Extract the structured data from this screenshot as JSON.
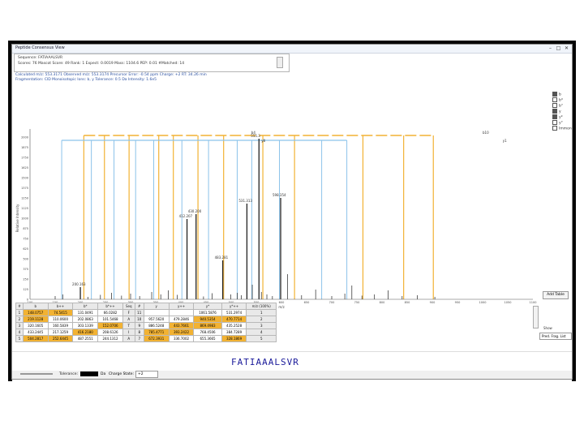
{
  "window": {
    "title": "Peptide Consensus View"
  },
  "header": {
    "sequence_line": "Sequence: FATIAAALSVR",
    "scores_line": "Scores: 76  Mascot Score: 49   Rank: 1  Expect: 0.0019   Mass: 1104.6   PEP: 0.01   #Matched: 14",
    "computed_line": "Calculated m/z: 553.3171  Observed m/z: 553.3174  Precursor Error: -0.54 ppm  Charge: +2  RT: 34.26 min",
    "extra_line": "Fragmentation: CID  Monoisotopic  Ions: b, y  Tolerance: 0.5 Da  Intensity: 1.6e5"
  },
  "legend": [
    {
      "label": "b",
      "checked": true
    },
    {
      "label": "b*",
      "checked": false
    },
    {
      "label": "b°",
      "checked": false
    },
    {
      "label": "y",
      "checked": true
    },
    {
      "label": "y*",
      "checked": true
    },
    {
      "label": "y°",
      "checked": false
    },
    {
      "label": "Immonium",
      "checked": false
    }
  ],
  "chart_data": {
    "type": "bar",
    "ylabel": "Relative Intensity",
    "ylim": [
      0,
      2000
    ],
    "yticks": [
      0,
      125,
      250,
      375,
      500,
      625,
      750,
      875,
      1000,
      1125,
      1250,
      1375,
      1500,
      1625,
      1750,
      1875,
      2000
    ],
    "xlim": [
      100,
      1100
    ],
    "xticks": [
      100,
      150,
      200,
      250,
      300,
      350,
      400,
      450,
      500,
      550,
      600,
      650,
      700,
      750,
      800,
      850,
      900,
      950,
      1000,
      1050,
      1100
    ],
    "xlabel": "m/z",
    "peaks_labeled": [
      {
        "x": 200.1,
        "y": 150,
        "label": "200.163"
      },
      {
        "x": 430.2,
        "y": 1050,
        "label": "430.200"
      },
      {
        "x": 412.2,
        "y": 990,
        "label": "412.207"
      },
      {
        "x": 483.3,
        "y": 480,
        "label": "483.281"
      },
      {
        "x": 531.3,
        "y": 1180,
        "label": "531.313"
      },
      {
        "x": 598.4,
        "y": 1250,
        "label": "598.354"
      },
      {
        "x": 555.3,
        "y": 1980,
        "label": "555.3"
      }
    ],
    "peaks_unlabeled": [
      [
        150,
        40
      ],
      [
        165,
        60
      ],
      [
        215,
        30
      ],
      [
        240,
        55
      ],
      [
        262,
        80
      ],
      [
        282,
        45
      ],
      [
        300,
        70
      ],
      [
        318,
        40
      ],
      [
        342,
        90
      ],
      [
        360,
        60
      ],
      [
        375,
        110
      ],
      [
        393,
        55
      ],
      [
        445,
        35
      ],
      [
        462,
        75
      ],
      [
        499,
        60
      ],
      [
        512,
        80
      ],
      [
        520,
        50
      ],
      [
        542,
        180
      ],
      [
        560,
        90
      ],
      [
        571,
        60
      ],
      [
        582,
        40
      ],
      [
        612,
        310
      ],
      [
        640,
        50
      ],
      [
        668,
        120
      ],
      [
        700,
        40
      ],
      [
        726,
        70
      ],
      [
        740,
        170
      ],
      [
        760,
        45
      ],
      [
        785,
        60
      ],
      [
        812,
        110
      ],
      [
        840,
        40
      ],
      [
        870,
        50
      ],
      [
        905,
        30
      ]
    ],
    "ion_lines_b": [
      207,
      248,
      297,
      356,
      385,
      434,
      485,
      563,
      626,
      762,
      843,
      902
    ],
    "ion_lines_y": [
      163,
      222,
      267,
      310,
      346,
      402,
      455,
      512,
      541,
      596,
      680,
      730
    ],
    "tags_top": [
      "b10",
      "y8",
      "b4",
      "y1"
    ]
  },
  "table": {
    "headers": [
      "#",
      "b",
      "b++",
      "b*",
      "b*++",
      "Seq",
      "#",
      "y",
      "y++",
      "y*",
      "y*++",
      "m/z (100%)"
    ],
    "rows": [
      [
        "1",
        "148.0757",
        "74.5415",
        "131.0491",
        "66.0282",
        "F",
        "11",
        "",
        "",
        "1061.5876",
        "531.2974",
        "1"
      ],
      [
        "2",
        "219.1128",
        "110.0600",
        "202.0863",
        "101.5468",
        "A",
        "10",
        "957.5620",
        "479.2846",
        "940.5354",
        "470.7714",
        "2"
      ],
      [
        "3",
        "320.1605",
        "160.5839",
        "303.1339",
        "152.0706",
        "T",
        "9",
        "886.5248",
        "443.7661",
        "869.4983",
        "435.2528",
        "3"
      ],
      [
        "4",
        "433.2445",
        "217.1259",
        "416.2180",
        "208.6126",
        "I",
        "8",
        "785.4771",
        "393.2422",
        "768.4506",
        "384.7289",
        "4"
      ],
      [
        "5",
        "504.2817",
        "252.6445",
        "487.2551",
        "244.1312",
        "A",
        "7",
        "672.3931",
        "336.7002",
        "655.3665",
        "328.1869",
        "5"
      ]
    ],
    "hit_cells": [
      [
        0,
        1
      ],
      [
        0,
        2
      ],
      [
        1,
        1
      ],
      [
        1,
        9
      ],
      [
        1,
        10
      ],
      [
        2,
        4
      ],
      [
        2,
        8
      ],
      [
        2,
        9
      ],
      [
        3,
        3
      ],
      [
        3,
        7
      ],
      [
        3,
        8
      ],
      [
        4,
        1
      ],
      [
        4,
        2
      ],
      [
        4,
        7
      ],
      [
        4,
        10
      ]
    ]
  },
  "controls": {
    "add_table": "Add Table",
    "show_label": "Show",
    "pred_select": "Pred. Frag. List",
    "tolerance_label": "Tolerance:",
    "tolerance_unit": "Da",
    "charge_label": "Charge State:",
    "charge_value": "+2"
  },
  "sequence": "FATIAAALSVR",
  "colors": {
    "b_ion": "#f2b233",
    "y_ion": "#8cc3ea",
    "peak": "#222222",
    "seq": "#1a1a9a"
  }
}
